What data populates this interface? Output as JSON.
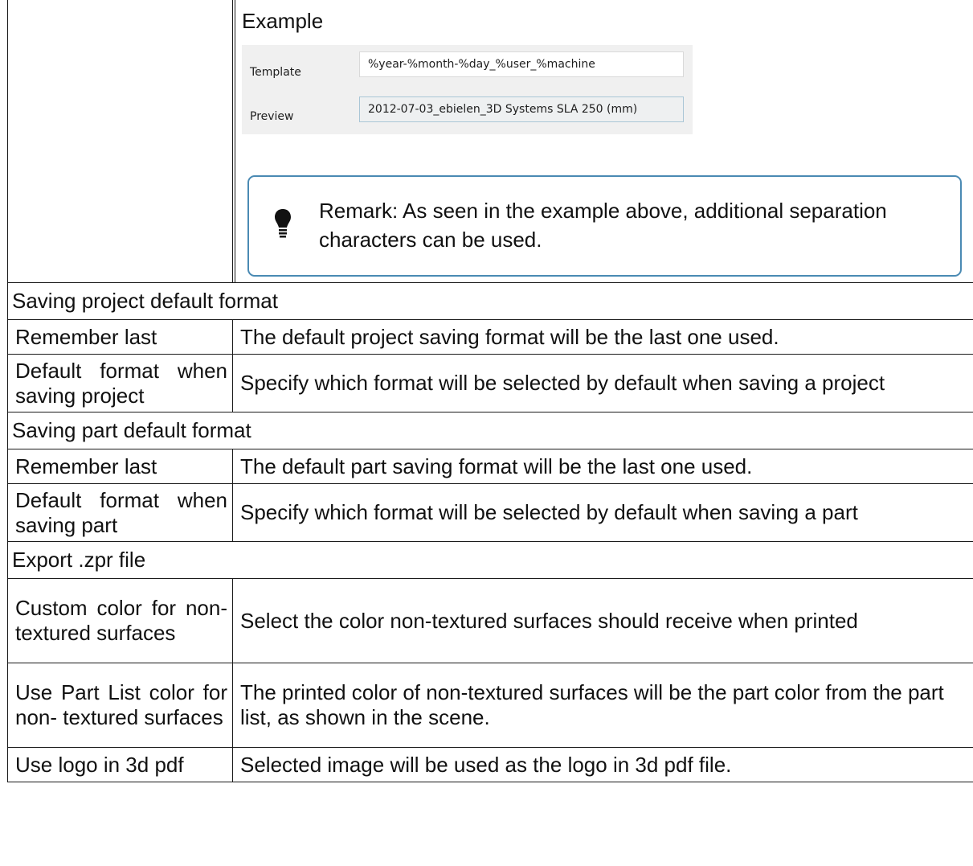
{
  "example": {
    "title": "Example",
    "dialog": {
      "template_label": "Template",
      "template_value": "%year-%month-%day_%user_%machine",
      "preview_label": "Preview",
      "preview_value": "2012-07-03_ebielen_3D Systems SLA 250 (mm)"
    },
    "remark": {
      "icon": "lightbulb-icon",
      "text": "Remark: As seen in the example above, additional separation characters can be used."
    }
  },
  "sections": {
    "project": {
      "heading": "Saving project default format",
      "rows": [
        {
          "term": "Remember last",
          "description": "The default project saving format will be the last one used."
        },
        {
          "term": "Default format when saving project",
          "description": "Specify which format will be selected by default when saving a project"
        }
      ]
    },
    "part": {
      "heading": "Saving part default format",
      "rows": [
        {
          "term": "Remember last",
          "description": "The default part saving format will be the last one used."
        },
        {
          "term": "Default format when saving part",
          "description": "Specify which format will be selected by default when saving a part"
        }
      ]
    },
    "zpr": {
      "heading": "Export .zpr file",
      "rows": [
        {
          "term": "Custom color for non- textured surfaces",
          "description": "Select the color non-textured surfaces should receive when printed"
        },
        {
          "term": "Use Part List color for non- textured surfaces",
          "description": "The printed color of non-textured surfaces will be the part color from the part list, as shown in the scene."
        },
        {
          "term": "Use logo in 3d pdf",
          "description": "Selected image will be used as the logo in 3d pdf file."
        }
      ]
    }
  },
  "colors": {
    "remark_border": "#4a8ab3",
    "dialog_background": "#f0f0f0",
    "table_border": "#1a1a1a"
  }
}
